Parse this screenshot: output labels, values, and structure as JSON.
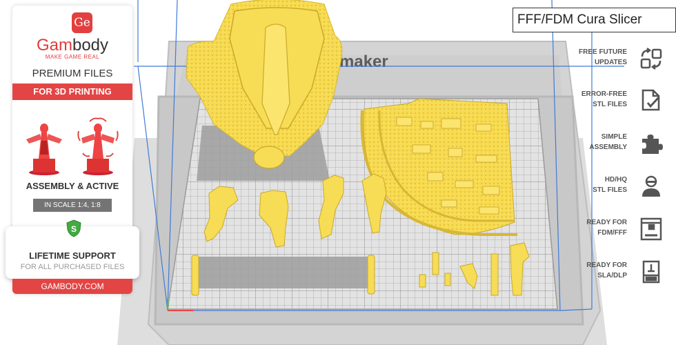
{
  "title": "FFF/FDM Cura Slicer",
  "printer_brand": "maker",
  "brand": {
    "logo_glyph": "Ge",
    "name_part1": "Gam",
    "name_part2": "body",
    "tagline": "MAKE GAME REAL"
  },
  "promo": {
    "premium": "PREMIUM FILES",
    "for_3d": "FOR 3D PRINTING",
    "assembly": "ASSEMBLY & ACTIVE",
    "scale": "IN SCALE 1:4, 1:8",
    "shield_letter": "S",
    "lifetime": "LIFETIME SUPPORT",
    "all_purchased": "FOR ALL PURCHASED FILES",
    "site": "GAMBODY.COM"
  },
  "features": [
    {
      "line1": "FREE FUTURE",
      "line2": "UPDATES",
      "icon": "update-arrows-icon"
    },
    {
      "line1": "ERROR-FREE",
      "line2": "STL FILES",
      "icon": "file-check-icon"
    },
    {
      "line1": "SIMPLE",
      "line2": "ASSEMBLY",
      "icon": "puzzle-icon"
    },
    {
      "line1": "HD/HQ",
      "line2": "STL FILES",
      "icon": "person-hq-icon"
    },
    {
      "line1": "READY FOR",
      "line2": "FDM/FFF",
      "icon": "fdm-printer-icon"
    },
    {
      "line1": "READY FOR",
      "line2": "SLA/DLP",
      "icon": "sla-printer-icon"
    }
  ],
  "colors": {
    "accent": "#e34545",
    "model": "#f7dc55",
    "build_plate": "#cfcfcf",
    "grid_line": "#a9a9a9",
    "volume_line": "#3f7ad6"
  }
}
